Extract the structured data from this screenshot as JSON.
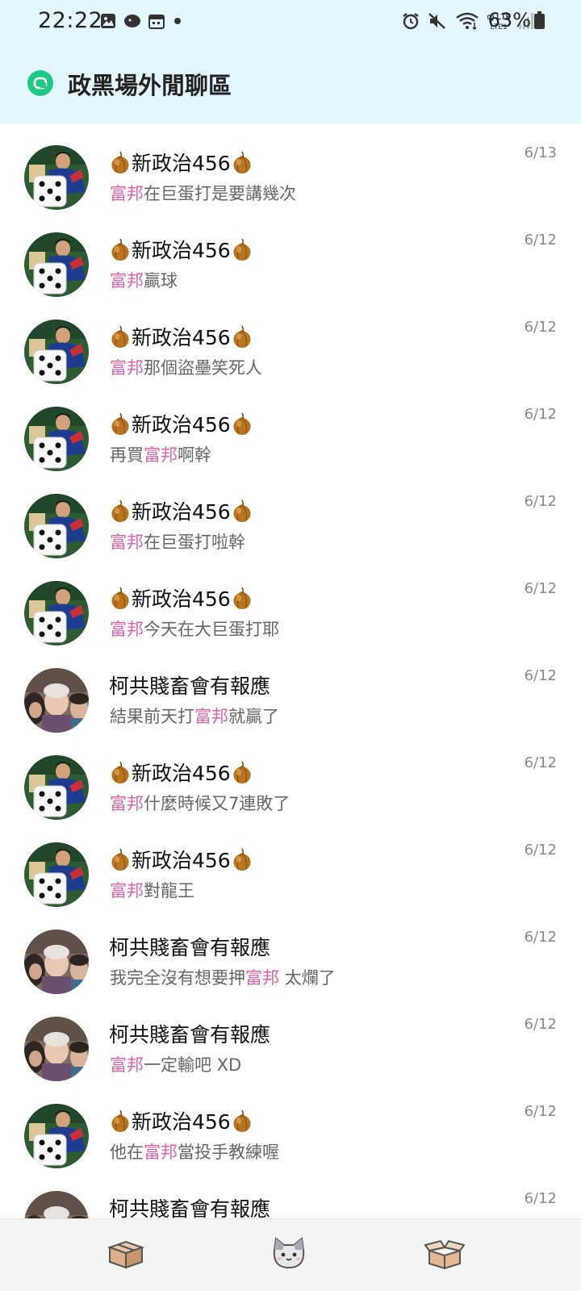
{
  "status_bar": {
    "time": "22:22",
    "battery_text": "63%",
    "network_label": "Vo) LTE1",
    "left_icons": [
      "gallery-icon",
      "messenger-icon",
      "calendar-icon",
      "dot-icon"
    ],
    "right_icons": [
      "alarm-icon",
      "mute-icon",
      "wifi-icon",
      "lte-icon",
      "signal-icon",
      "battery-icon"
    ]
  },
  "header": {
    "title": "政黑場外閒聊區",
    "badge_icon": "board-badge-icon",
    "badge_color": "#1ec985",
    "background": "#e3f6fc"
  },
  "highlight_color": "#df62a8",
  "messages": [
    {
      "avatar": "avatar-dice-man",
      "name": "新政治456",
      "onions": true,
      "date": "6/13",
      "preview": [
        {
          "t": "富邦",
          "hl": true
        },
        {
          "t": "在巨蛋打是要講幾次",
          "hl": false
        }
      ]
    },
    {
      "avatar": "avatar-dice-man",
      "name": "新政治456",
      "onions": true,
      "date": "6/12",
      "preview": [
        {
          "t": "富邦",
          "hl": true
        },
        {
          "t": "贏球",
          "hl": false
        }
      ]
    },
    {
      "avatar": "avatar-dice-man",
      "name": "新政治456",
      "onions": true,
      "date": "6/12",
      "preview": [
        {
          "t": "富邦",
          "hl": true
        },
        {
          "t": "那個盜壘笑死人",
          "hl": false
        }
      ]
    },
    {
      "avatar": "avatar-dice-man",
      "name": "新政治456",
      "onions": true,
      "date": "6/12",
      "preview": [
        {
          "t": "再買",
          "hl": false
        },
        {
          "t": "富邦",
          "hl": true
        },
        {
          "t": "啊幹",
          "hl": false
        }
      ]
    },
    {
      "avatar": "avatar-dice-man",
      "name": "新政治456",
      "onions": true,
      "date": "6/12",
      "preview": [
        {
          "t": "富邦",
          "hl": true
        },
        {
          "t": "在巨蛋打啦幹",
          "hl": false
        }
      ]
    },
    {
      "avatar": "avatar-dice-man",
      "name": "新政治456",
      "onions": true,
      "date": "6/12",
      "preview": [
        {
          "t": "富邦",
          "hl": true
        },
        {
          "t": "今天在大巨蛋打耶",
          "hl": false
        }
      ]
    },
    {
      "avatar": "avatar-elders",
      "name": "柯共賤畜會有報應",
      "onions": false,
      "date": "6/12",
      "preview": [
        {
          "t": "結果前天打",
          "hl": false
        },
        {
          "t": "富邦",
          "hl": true
        },
        {
          "t": "就贏了",
          "hl": false
        }
      ]
    },
    {
      "avatar": "avatar-dice-man",
      "name": "新政治456",
      "onions": true,
      "date": "6/12",
      "preview": [
        {
          "t": "富邦",
          "hl": true
        },
        {
          "t": "什麼時候又7連敗了",
          "hl": false
        }
      ]
    },
    {
      "avatar": "avatar-dice-man",
      "name": "新政治456",
      "onions": true,
      "date": "6/12",
      "preview": [
        {
          "t": "富邦",
          "hl": true
        },
        {
          "t": "對龍王",
          "hl": false
        }
      ]
    },
    {
      "avatar": "avatar-elders",
      "name": "柯共賤畜會有報應",
      "onions": false,
      "date": "6/12",
      "preview": [
        {
          "t": "我完全沒有想要押",
          "hl": false
        },
        {
          "t": "富邦",
          "hl": true
        },
        {
          "t": " 太爛了",
          "hl": false
        }
      ]
    },
    {
      "avatar": "avatar-elders",
      "name": "柯共賤畜會有報應",
      "onions": false,
      "date": "6/12",
      "preview": [
        {
          "t": "富邦",
          "hl": true
        },
        {
          "t": "一定輸吧 XD",
          "hl": false
        }
      ]
    },
    {
      "avatar": "avatar-dice-man",
      "name": "新政治456",
      "onions": true,
      "date": "6/12",
      "preview": [
        {
          "t": "他在",
          "hl": false
        },
        {
          "t": "富邦",
          "hl": true
        },
        {
          "t": "當投手教練喔",
          "hl": false
        }
      ]
    },
    {
      "avatar": "avatar-elders",
      "name": "柯共賤畜會有報應",
      "onions": false,
      "date": "6/12",
      "preview": []
    }
  ],
  "bottom_nav": [
    {
      "name": "box-closed-icon",
      "label": ""
    },
    {
      "name": "cat-icon",
      "label": ""
    },
    {
      "name": "box-open-icon",
      "label": ""
    }
  ]
}
